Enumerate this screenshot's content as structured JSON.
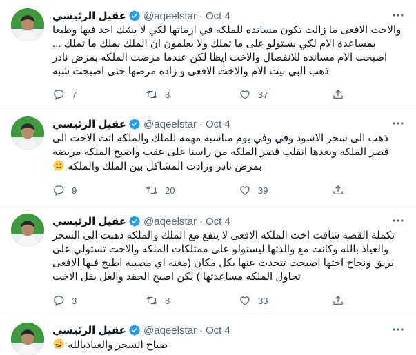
{
  "user": {
    "name": "عقيل الرئيسي",
    "handle": "@aqeelstar",
    "separator": "·"
  },
  "tweets": [
    {
      "date": "Oct 4",
      "text": "والاخت الافعى ما زالت تكون مسانده للملكه في ازماتها لكي لا يشك احد فيها وطبعا بمساعدة الام لكي يستولو على ما تملك ولا يعلمون ان الملك يملك ما تملك ... اصبحت الام مسانده للانفصال والاخت ايظا لكن عندما مرضت الملكه بمرض نادر ذهب البي بيت الام والاخت الافعى و زاده مرضها حتى اصبحت شبه",
      "replies": "7",
      "retweets": "8",
      "likes": "37"
    },
    {
      "date": "Oct 4",
      "text": "ذهب الى سحر الاسود وفي وفي يوم مناسبه مهمه للملك والملكه اتت الاخت الى قصر الملكه وبعدها انقلب قصر الملكه من راسنا على عقب واصبح الملكه مريضه بمرض نادر وزادت المشاكل بين الملك والملكه",
      "emoji": "slightly-smiling-face",
      "replies": "9",
      "retweets": "20",
      "likes": "39"
    },
    {
      "date": "Oct 4",
      "text": "تكملة القصه شافت اخت الملكه الافعى لا ينفع مع الملك والملكه ذهبت الى السحر والعياذ بالله وكانت مع والدتها ليستولو على ممتلكات الملكه والاخت تستولي على بريق ونجاح اختها اصبحت تتحدث عنها بكل مكان (معنه اي مصيبه اطيح فيها الافعى تحاول الملكه مساعدتها ) لكن اصبح الحقد والغل يقل الاخت",
      "replies": "3",
      "retweets": "8",
      "likes": "33"
    },
    {
      "date": "Oct 4",
      "text": "صباح السحر والعياذبالله",
      "emoji": "rolling-on-floor-laughing"
    }
  ],
  "colors": {
    "verified": "#1d9bf0",
    "muted": "#536471",
    "text": "#0f1419",
    "divider": "#eff3f4"
  },
  "icons": [
    "more-icon",
    "verified-badge-icon",
    "reply-icon",
    "retweet-icon",
    "like-icon",
    "share-icon"
  ]
}
